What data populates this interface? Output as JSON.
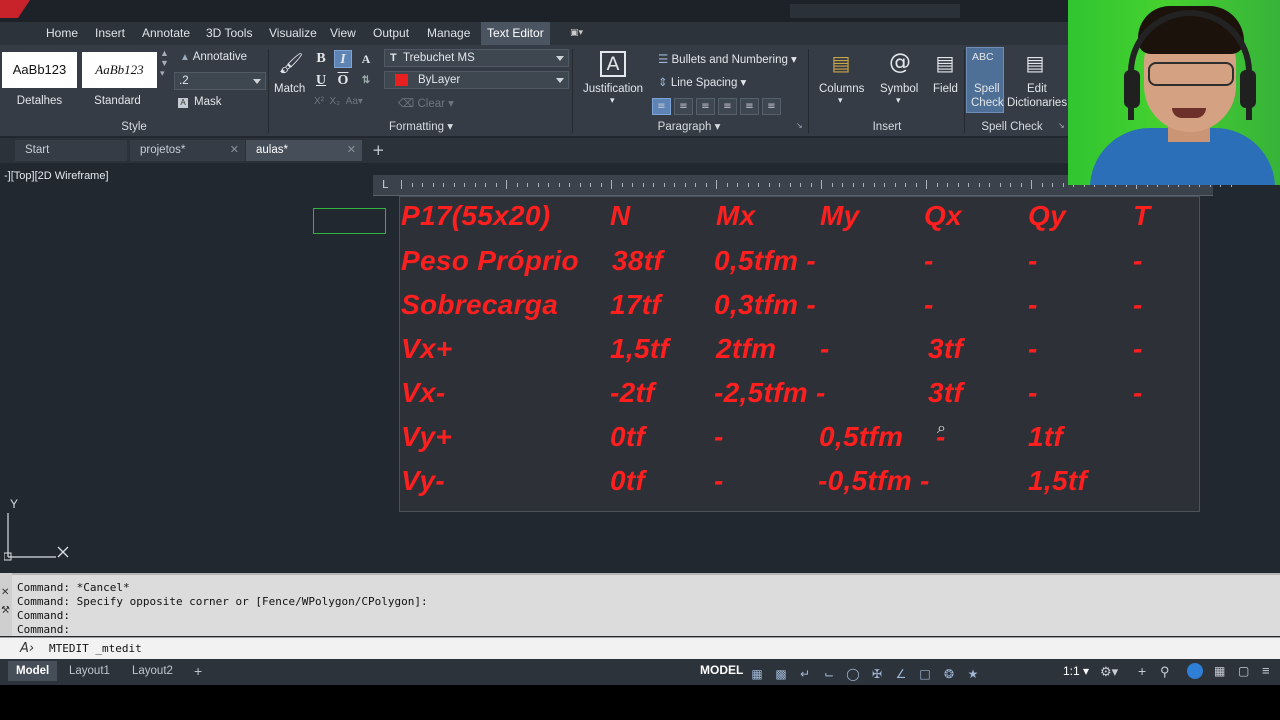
{
  "menu": {
    "tabs": [
      "Home",
      "Insert",
      "Annotate",
      "3D Tools",
      "Visualize",
      "View",
      "Output",
      "Manage",
      "Text Editor"
    ]
  },
  "ribbon": {
    "style": {
      "title": "Style",
      "style1_preview": "AaBb123",
      "style1_label": "Detalhes",
      "style2_preview": "AaBb123",
      "style2_label": "Standard",
      "annotative_label": "Annotative",
      "text_height": ".2",
      "mask_label": "Mask"
    },
    "formatting": {
      "title": "Formatting",
      "match_label": "Match",
      "font": "Trebuchet MS",
      "color": "ByLayer",
      "color_swatch": "#e82020",
      "clear_label": "Clear"
    },
    "paragraph": {
      "title": "Paragraph",
      "justification_label": "Justification",
      "bullets_label": "Bullets and Numbering",
      "line_spacing_label": "Line Spacing"
    },
    "insert": {
      "title": "Insert",
      "columns_label": "Columns",
      "symbol_label": "Symbol",
      "field_label": "Field"
    },
    "spellcheck": {
      "title": "Spell Check",
      "spell_label_1": "Spell",
      "spell_label_2": "Check",
      "edit_label_1": "Edit",
      "edit_label_2": "Dictionaries",
      "abc": "ABC"
    }
  },
  "file_tabs": [
    {
      "label": "Start"
    },
    {
      "label": "projetos*"
    },
    {
      "label": "aulas*"
    }
  ],
  "viewport_label": "-][Top][2D Wireframe]",
  "ruler_label": "L",
  "table": {
    "header": [
      "P17(55x20)",
      "N",
      "Mx",
      "My",
      "Qx",
      "Qy",
      "T"
    ],
    "rows": [
      [
        "Peso Próprio",
        "38tf",
        "0,5tfm -",
        "",
        "-",
        "-",
        "-"
      ],
      [
        "Sobrecarga",
        "17tf",
        "0,3tfm -",
        "",
        "-",
        "-",
        "-"
      ],
      [
        "Vx+",
        "1,5tf",
        "2tfm",
        "-",
        "3tf",
        "-",
        "-"
      ],
      [
        "Vx-",
        "-2tf",
        "-2,5tfm -",
        "",
        "3tf",
        "-",
        "-"
      ],
      [
        "Vy+",
        "0tf",
        "-",
        "0,5tfm",
        "-",
        "1tf",
        ""
      ],
      [
        "Vy-",
        "0tf",
        "-",
        "-0,5tfm -",
        "",
        "1,5tf",
        ""
      ]
    ],
    "text_color": "#ff1f1f"
  },
  "ucs": {
    "y_label": "Y"
  },
  "command_history": [
    "Command: *Cancel*",
    "Command: Specify opposite corner or [Fence/WPolygon/CPolygon]:",
    "Command:",
    "Command:"
  ],
  "command_input": "MTEDIT _mtedit",
  "layout_tabs": [
    "Model",
    "Layout1",
    "Layout2"
  ],
  "status": {
    "model_label": "MODEL",
    "scale": "1:1"
  }
}
